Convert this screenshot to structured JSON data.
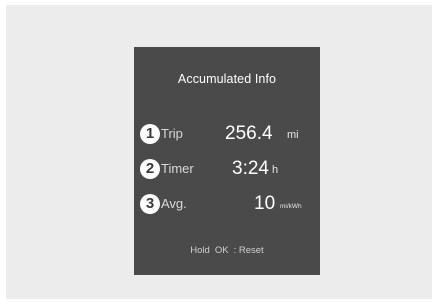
{
  "screen": {
    "title": "Accumulated Info",
    "rows": [
      {
        "number": "1",
        "label": "Trip",
        "value": "256.4",
        "unit": "mi"
      },
      {
        "number": "2",
        "label": "Timer",
        "value": "3:24",
        "unit": "h"
      },
      {
        "number": "3",
        "label": "Avg.",
        "value": "10",
        "unit": "mi/kWh"
      }
    ],
    "footer": {
      "hold": "Hold",
      "ok": "OK",
      "reset": ": Reset"
    }
  },
  "colors": {
    "panel_bg": "#4a4a4a",
    "frame_bg": "#ececec",
    "text": "#ffffff"
  }
}
